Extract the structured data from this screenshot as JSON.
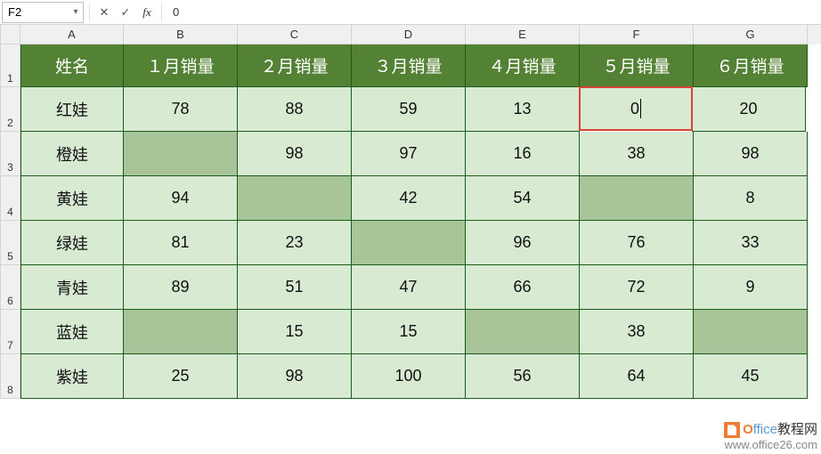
{
  "formula_bar": {
    "cell_ref": "F2",
    "cancel_label": "✕",
    "confirm_label": "✓",
    "fx_label": "fx",
    "formula_value": "0"
  },
  "columns": [
    "A",
    "B",
    "C",
    "D",
    "E",
    "F",
    "G"
  ],
  "row_numbers": [
    "1",
    "2",
    "3",
    "4",
    "5",
    "6",
    "7",
    "8"
  ],
  "header_row": {
    "a": "姓名",
    "b": "１月销量",
    "c": "２月销量",
    "d": "３月销量",
    "e": "４月销量",
    "f": "５月销量",
    "g": "６月销量"
  },
  "rows": [
    {
      "a": "红娃",
      "b": "78",
      "c": "88",
      "d": "59",
      "e": "13",
      "f": "0",
      "g": "20",
      "empty": [],
      "editing": "f"
    },
    {
      "a": "橙娃",
      "b": "",
      "c": "98",
      "d": "97",
      "e": "16",
      "f": "38",
      "g": "98",
      "empty": [
        "b"
      ]
    },
    {
      "a": "黄娃",
      "b": "94",
      "c": "",
      "d": "42",
      "e": "54",
      "f": "",
      "g": "8",
      "empty": [
        "c",
        "f"
      ]
    },
    {
      "a": "绿娃",
      "b": "81",
      "c": "23",
      "d": "",
      "e": "96",
      "f": "76",
      "g": "33",
      "empty": [
        "d"
      ]
    },
    {
      "a": "青娃",
      "b": "89",
      "c": "51",
      "d": "47",
      "e": "66",
      "f": "72",
      "g": "9",
      "empty": []
    },
    {
      "a": "蓝娃",
      "b": "",
      "c": "15",
      "d": "15",
      "e": "",
      "f": "38",
      "g": "",
      "empty": [
        "b",
        "e",
        "g"
      ]
    },
    {
      "a": "紫娃",
      "b": "25",
      "c": "98",
      "d": "100",
      "e": "56",
      "f": "64",
      "g": "45",
      "empty": []
    }
  ],
  "watermark": {
    "brand_o": "O",
    "brand_rest": "ffice",
    "brand_cn": "教程网",
    "url": "www.office26.com"
  }
}
